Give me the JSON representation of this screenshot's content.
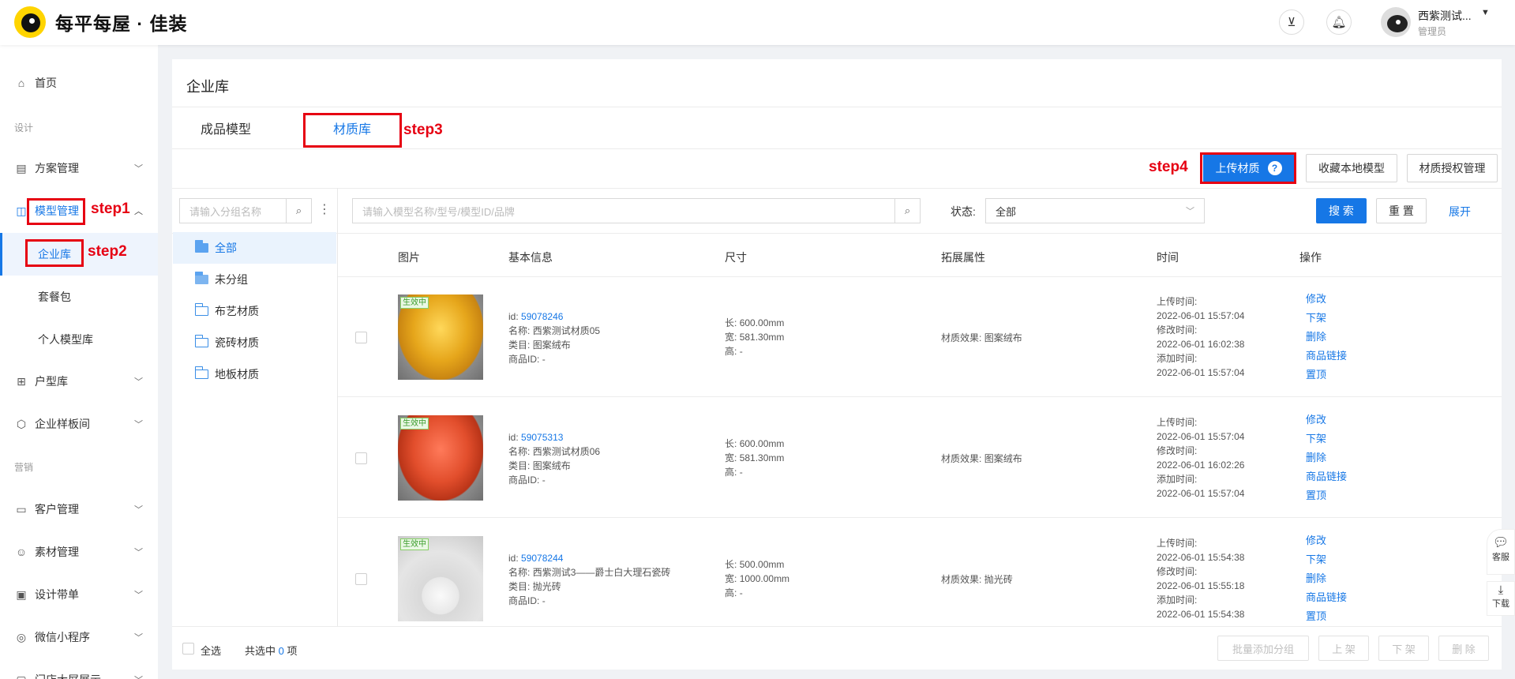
{
  "header": {
    "brand": "每平每屋 · 佳装",
    "user_name": "西紫测试...",
    "user_role": "管理员"
  },
  "sidebar": {
    "home": "首页",
    "sec_design": "设计",
    "scheme": "方案管理",
    "model_mgmt": "模型管理",
    "enterprise": "企业库",
    "package": "套餐包",
    "personal": "个人模型库",
    "floorplan": "户型库",
    "sample": "企业样板间",
    "sec_marketing": "营销",
    "customer": "客户管理",
    "material": "素材管理",
    "design_order": "设计带单",
    "wechat": "微信小程序",
    "store": "门店大屏展示"
  },
  "page": {
    "title": "企业库",
    "tab_products": "成品模型",
    "tab_materials": "材质库"
  },
  "steps": {
    "s1": "step1",
    "s2": "step2",
    "s3": "step3",
    "s4": "step4"
  },
  "toolbar": {
    "upload": "上传材质",
    "collect": "收藏本地模型",
    "auth": "材质授权管理"
  },
  "filter": {
    "group_ph": "请输入分组名称",
    "model_ph": "请输入模型名称/型号/模型ID/品牌",
    "status_label": "状态:",
    "status_value": "全部",
    "search": "搜 索",
    "reset": "重 置",
    "expand": "展开"
  },
  "tree": [
    "全部",
    "未分组",
    "布艺材质",
    "瓷砖材质",
    "地板材质"
  ],
  "columns": {
    "image": "图片",
    "basic": "基本信息",
    "size": "尺寸",
    "ext": "拓展属性",
    "time": "时间",
    "ops": "操作"
  },
  "status_badge": "生效中",
  "labels": {
    "id": "id:",
    "name": "名称:",
    "category": "类目:",
    "product_id": "商品ID:",
    "len": "长:",
    "width": "宽:",
    "height": "高:",
    "effect": "材质效果:",
    "uploaded": "上传时间:",
    "modified": "修改时间:",
    "added": "添加时间:"
  },
  "ops": [
    "修改",
    "下架",
    "删除",
    "商品链接",
    "置顶"
  ],
  "rows": [
    {
      "id": "59078246",
      "name": "西紫测试材质05",
      "category": "图案绒布",
      "pid": "-",
      "len": "600.00mm",
      "width": "581.30mm",
      "height": "-",
      "effect": "图案绒布",
      "upload": "2022-06-01 15:57:04",
      "modify": "2022-06-01 16:02:38",
      "add": "2022-06-01 15:57:04"
    },
    {
      "id": "59075313",
      "name": "西紫测试材质06",
      "category": "图案绒布",
      "pid": "-",
      "len": "600.00mm",
      "width": "581.30mm",
      "height": "-",
      "effect": "图案绒布",
      "upload": "2022-06-01 15:57:04",
      "modify": "2022-06-01 16:02:26",
      "add": "2022-06-01 15:57:04"
    },
    {
      "id": "59078244",
      "name": "西紫测试3——爵士白大理石瓷砖",
      "category": "抛光砖",
      "pid": "-",
      "len": "500.00mm",
      "width": "1000.00mm",
      "height": "-",
      "effect": "抛光砖",
      "upload": "2022-06-01 15:54:38",
      "modify": "2022-06-01 15:55:18",
      "add": "2022-06-01 15:54:38"
    }
  ],
  "footer": {
    "select_all": "全选",
    "selected_prefix": "共选中",
    "selected_count": "0",
    "selected_suffix": "项",
    "batch_group": "批量添加分组",
    "up": "上 架",
    "down": "下 架",
    "delete": "删 除"
  },
  "float": {
    "service": "客服",
    "download": "下载"
  }
}
